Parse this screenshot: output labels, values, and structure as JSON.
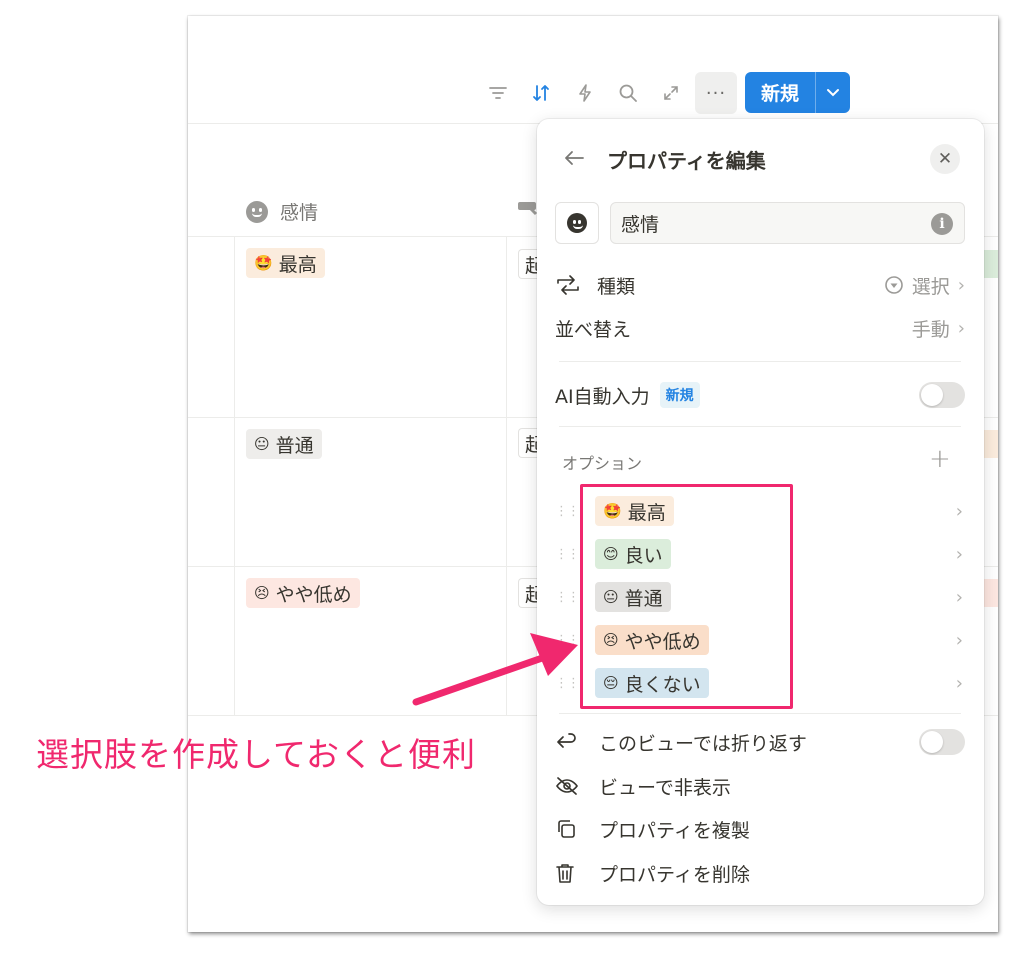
{
  "toolbar": {
    "icons": [
      "filter-icon",
      "sort-icon",
      "lightning-icon",
      "search-icon",
      "expand-icon",
      "more-icon"
    ],
    "more_label": "···",
    "new_button_label": "新規",
    "sort_active_color": "#2383e2"
  },
  "table": {
    "column_header": "感情",
    "rows": [
      {
        "emoji": "🤩",
        "label": "最高",
        "bg": "#fbecdd",
        "partial": "起"
      },
      {
        "emoji": "😐",
        "label": "普通",
        "bg": "#eeedeb",
        "partial": "起"
      },
      {
        "emoji": "😣",
        "label": "やや低め",
        "bg": "#fde7e1",
        "partial": "起"
      }
    ]
  },
  "popup": {
    "title": "プロパティを編集",
    "property_name": "感情",
    "type_label": "種類",
    "type_value": "選択",
    "sort_label": "並べ替え",
    "sort_value": "手動",
    "ai_label": "AI自動入力",
    "ai_badge": "新規",
    "options_label": "オプション",
    "options": [
      {
        "emoji": "🤩",
        "label": "最高",
        "bg": "#fbecdd"
      },
      {
        "emoji": "😊",
        "label": "良い",
        "bg": "#dbeddb"
      },
      {
        "emoji": "😐",
        "label": "普通",
        "bg": "#e3e2e0"
      },
      {
        "emoji": "😣",
        "label": "やや低め",
        "bg": "#fadec9"
      },
      {
        "emoji": "😔",
        "label": "良くない",
        "bg": "#d3e5ef"
      }
    ],
    "wrap_label": "このビューでは折り返す",
    "hide_label": "ビューで非表示",
    "duplicate_label": "プロパティを複製",
    "delete_label": "プロパティを削除"
  },
  "annotation": {
    "text": "選択肢を作成しておくと便利",
    "color": "#f0286e"
  }
}
